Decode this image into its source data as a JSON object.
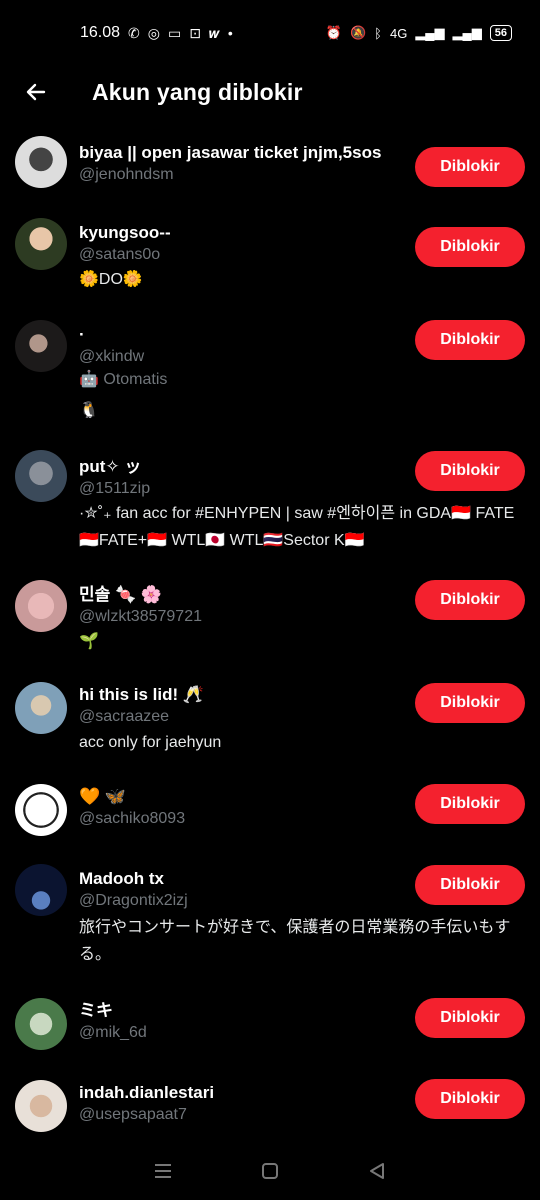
{
  "status_bar": {
    "time": "16.08",
    "network": "4G",
    "battery": "56"
  },
  "header": {
    "title": "Akun yang diblokir"
  },
  "blocked_button_label": "Diblokir",
  "users": [
    {
      "name": "biyaa || open jasawar ticket jnjm,5sos",
      "handle": "@jenohndsm",
      "bio": ""
    },
    {
      "name": "kyungsoo--",
      "handle": "@satans0o",
      "bio": "🌼DO🌼"
    },
    {
      "name": "·",
      "handle": "@xkindw",
      "auto": "Otomatis",
      "bio": "🐧"
    },
    {
      "name": "put✧ ッ",
      "handle": "@1511zip",
      "bio": "·✮˚₊ fan acc for #ENHYPEN | saw #엔하이픈 in GDA🇮🇩 FATE🇮🇩FATE+🇮🇩 WTL🇯🇵 WTL🇹🇭Sector K🇮🇩"
    },
    {
      "name": "민솔 🍬 🌸",
      "handle": "@wlzkt38579721",
      "bio": "    🌱"
    },
    {
      "name": "hi this is lid! 🥂",
      "handle": "@sacraazee",
      "bio": "acc only for jaehyun"
    },
    {
      "name": "🧡 🦋",
      "handle": "@sachiko8093",
      "bio": ""
    },
    {
      "name": "Madooh tx",
      "handle": "@Dragontix2izj",
      "bio": "旅行やコンサートが好きで、保護者の日常業務の手伝いもする。"
    },
    {
      "name": "ミキ",
      "handle": "@mik_6d",
      "bio": ""
    },
    {
      "name": "indah.dianlestari",
      "handle": "@usepsapaat7",
      "bio": ""
    }
  ]
}
